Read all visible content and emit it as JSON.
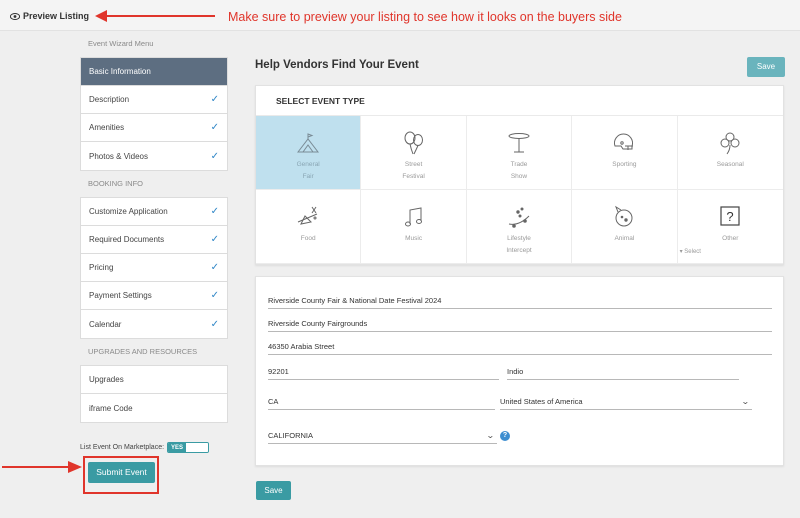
{
  "topbar": {
    "preview_label": "Preview Listing",
    "annotation": "Make sure to preview your listing to see how it looks on the buyers side"
  },
  "sidebar": {
    "menu_heading": "Event Wizard Menu",
    "sections": [
      {
        "heading": "",
        "items": [
          {
            "label": "Basic Information",
            "active": true,
            "checked": false
          },
          {
            "label": "Description",
            "checked": true
          },
          {
            "label": "Amenities",
            "checked": true
          },
          {
            "label": "Photos & Videos",
            "checked": true
          }
        ]
      },
      {
        "heading": "BOOKING INFO",
        "items": [
          {
            "label": "Customize Application",
            "checked": true
          },
          {
            "label": "Required Documents",
            "checked": true
          },
          {
            "label": "Pricing",
            "checked": true
          },
          {
            "label": "Payment Settings",
            "checked": true
          },
          {
            "label": "Calendar",
            "checked": true
          }
        ]
      },
      {
        "heading": "UPGRADES AND RESOURCES",
        "items": [
          {
            "label": "Upgrades",
            "checked": false
          },
          {
            "label": "iframe Code",
            "checked": false
          }
        ]
      }
    ],
    "check_glyph": "✓",
    "marketplace_label": "List Event On Marketplace:",
    "toggle_label": "YES",
    "toggle_on": true,
    "submit_label": "Submit Event"
  },
  "main": {
    "title": "Help Vendors Find Your Event",
    "save_label": "Save",
    "type_heading": "SELECT EVENT TYPE",
    "types": [
      {
        "label": "General\nFair",
        "icon": "tent-icon",
        "selected": true
      },
      {
        "label": "Street\nFestival",
        "icon": "balloons-icon"
      },
      {
        "label": "Trade\nShow",
        "icon": "table-icon"
      },
      {
        "label": "Sporting",
        "icon": "helmet-icon"
      },
      {
        "label": "Seasonal",
        "icon": "clover-icon"
      },
      {
        "label": "Food",
        "icon": "food-icon"
      },
      {
        "label": "Music",
        "icon": "music-note-icon"
      },
      {
        "label": "Lifestyle\nIntercept",
        "icon": "skateboard-icon"
      },
      {
        "label": "Animal",
        "icon": "animal-icon"
      },
      {
        "label": "Other",
        "icon": "question-box-icon"
      }
    ],
    "other_select": "▾ Select",
    "form": {
      "event_name": "Riverside County Fair & National Date Festival 2024",
      "venue": "Riverside County Fairgrounds",
      "address": "46350 Arabia Street",
      "zip": "92201",
      "city": "Indio",
      "state_abbr": "CA",
      "country": "United States of America",
      "region": "CALIFORNIA",
      "help": "?"
    },
    "bottom_save_label": "Save"
  },
  "colors": {
    "accent": "#3a9ba3",
    "annotation": "#e0352b",
    "active_menu": "#5d6e81",
    "selected_tile": "#bfe0ee",
    "check": "#2f86c7"
  }
}
